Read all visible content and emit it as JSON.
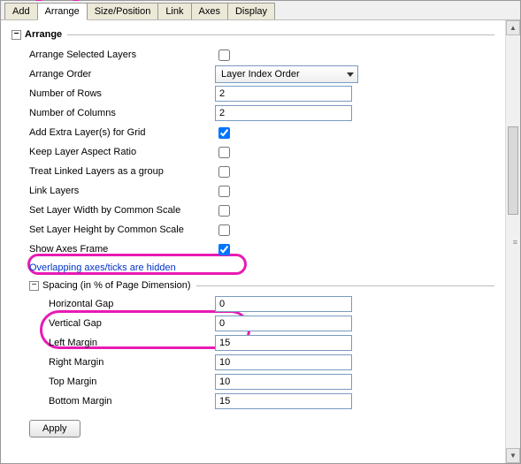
{
  "tabs": {
    "add": "Add",
    "arrange": "Arrange",
    "sizepos": "Size/Position",
    "link": "Link",
    "axes": "Axes",
    "display": "Display"
  },
  "toggle": {
    "minus": "−"
  },
  "section": {
    "title": "Arrange",
    "arrange_selected_layers": "Arrange Selected Layers",
    "arrange_order": "Arrange Order",
    "arrange_order_value": "Layer Index Order",
    "num_rows": "Number of Rows",
    "num_rows_value": "2",
    "num_cols": "Number of Columns",
    "num_cols_value": "2",
    "add_extra": "Add Extra Layer(s) for Grid",
    "keep_aspect": "Keep Layer Aspect Ratio",
    "treat_linked": "Treat Linked Layers as a group",
    "link_layers": "Link Layers",
    "width_common": "Set Layer Width by Common Scale",
    "height_common": "Set Layer Height by Common Scale",
    "show_axes_frame": "Show Axes Frame",
    "overlap_note": "Overlapping axes/ticks are hidden"
  },
  "checks": {
    "arrange_selected_layers": false,
    "add_extra": true,
    "keep_aspect": false,
    "treat_linked": false,
    "link_layers": false,
    "width_common": false,
    "height_common": false,
    "show_axes_frame": true
  },
  "spacing": {
    "title": "Spacing (in % of Page Dimension)",
    "hgap_label": "Horizontal Gap",
    "hgap_value": "0",
    "vgap_label": "Vertical Gap",
    "vgap_value": "0",
    "lmargin_label": "Left Margin",
    "lmargin_value": "15",
    "rmargin_label": "Right Margin",
    "rmargin_value": "10",
    "tmargin_label": "Top Margin",
    "tmargin_value": "10",
    "bmargin_label": "Bottom Margin",
    "bmargin_value": "15"
  },
  "buttons": {
    "apply": "Apply"
  },
  "scroll": {
    "up": "▲",
    "down": "▼",
    "grip": "≡"
  }
}
